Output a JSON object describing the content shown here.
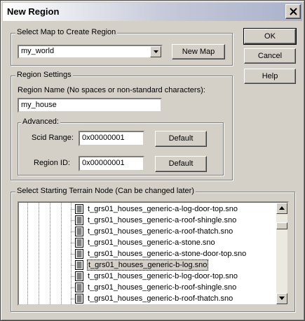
{
  "window": {
    "title": "New Region"
  },
  "map_group": {
    "label": "Select Map to Create Region",
    "selected_map": "my_world",
    "new_map_label": "New Map"
  },
  "region_group": {
    "label": "Region Settings",
    "name_label": "Region Name (No spaces or non-standard characters):",
    "name_value": "my_house",
    "advanced_label": "Advanced:",
    "scid_label": "Scid Range:",
    "scid_value": "0x00000001",
    "scid_default_label": "Default",
    "region_id_label": "Region ID:",
    "region_id_value": "0x00000001",
    "region_id_default_label": "Default"
  },
  "buttons": {
    "ok": "OK",
    "cancel": "Cancel",
    "help": "Help"
  },
  "terrain_group": {
    "label": "Select Starting Terrain Node (Can be changed later)",
    "items": [
      "t_grs01_houses_generic-a-log-door-top.sno",
      "t_grs01_houses_generic-a-roof-shingle.sno",
      "t_grs01_houses_generic-a-roof-thatch.sno",
      "t_grs01_houses_generic-a-stone.sno",
      "t_grs01_houses_generic-a-stone-door-top.sno",
      "t_grs01_houses_generic-b-log.sno",
      "t_grs01_houses_generic-b-log-door-top.sno",
      "t_grs01_houses_generic-b-roof-shingle.sno",
      "t_grs01_houses_generic-b-roof-thatch.sno"
    ],
    "selected_item": "t_grs01_houses_generic-b-log.sno",
    "scroll_position": 0.12
  },
  "icons": {
    "close": "close-icon",
    "dropdown": "chevron-down-icon",
    "file": "file-icon",
    "scroll_up": "scroll-up-arrow-icon",
    "scroll_down": "scroll-down-arrow-icon"
  }
}
